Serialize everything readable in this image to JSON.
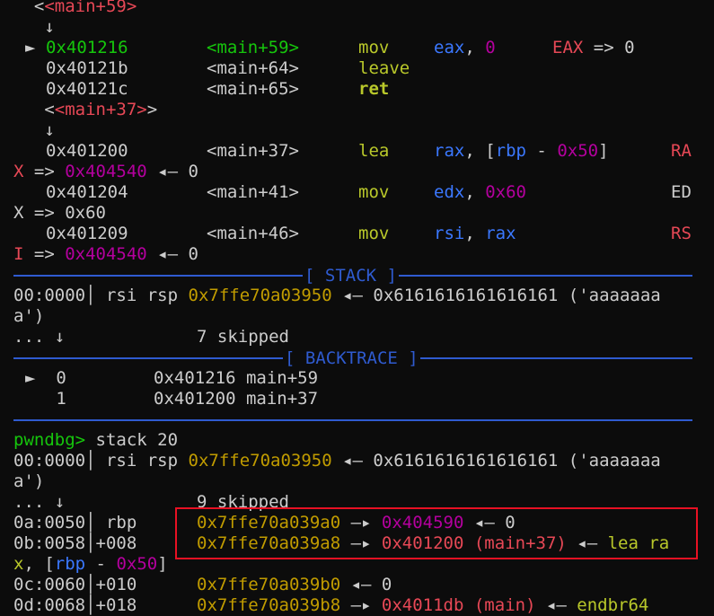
{
  "disasm": {
    "target_top": "<main+59>",
    "arrow_top": "↓",
    "current_marker": "►",
    "rows": [
      {
        "addr": "0x401216",
        "sym": "<main+59>",
        "op": "mov",
        "args": [
          "eax",
          ", ",
          "0"
        ],
        "annot": "EAX => 0"
      },
      {
        "addr": "0x40121b",
        "sym": "<main+64>",
        "op": "leave"
      },
      {
        "addr": "0x40121c",
        "sym": "<main+65>",
        "op": "ret"
      }
    ],
    "target_mid": "<main+37>",
    "arrow_mid": "↓",
    "rows2": [
      {
        "addr": "0x401200",
        "sym": "<main+37>",
        "op": "lea",
        "reg": "rax",
        "mem_open": ", [",
        "base": "rbp",
        "minus": " - ",
        "off": "0x50",
        "mem_close": "]",
        "annot_a": "RA",
        "annot_b": "X",
        "res_sep": " => ",
        "result": "0x404540",
        "deref": " ◂— 0"
      },
      {
        "addr": "0x401204",
        "sym": "<main+41>",
        "op": "mov",
        "reg": "edx",
        "sep": ", ",
        "val": "0x60",
        "annot_a": "ED",
        "annot_b": "X",
        "res_text": " => 0x60"
      },
      {
        "addr": "0x401209",
        "sym": "<main+46>",
        "op": "mov",
        "reg": "rsi",
        "sep": ", ",
        "src": "rax",
        "annot_a": "RS",
        "annot_b": "I",
        "res_sep": " => ",
        "result": "0x404540",
        "deref": " ◂— 0"
      }
    ]
  },
  "stack_header": "[ STACK ]",
  "stack": {
    "idx": "00:0000",
    "regs": "rsi rsp",
    "addr": "0x7ffe70a03950",
    "arrow": " ◂— ",
    "value": "0x6161616161616161 ('aaaaaaa",
    "value_wrap": "a')",
    "skip_dots": "... ↓",
    "skip_text": "7 skipped"
  },
  "backtrace_header": "[ BACKTRACE ]",
  "backtrace": [
    {
      "marker": "►",
      "idx": "0",
      "addr": "0x401216",
      "sym": "main+59"
    },
    {
      "marker": " ",
      "idx": "1",
      "addr": "0x401200",
      "sym": "main+37"
    }
  ],
  "command": {
    "prompt": "pwndbg>",
    "text": " stack 20"
  },
  "stack2": {
    "row0": {
      "idx": "00:0000",
      "regs": "rsi rsp",
      "addr": "0x7ffe70a03950",
      "arrow": " ◂— ",
      "value": "0x6161616161616161 ('aaaaaaa",
      "wrap": "a')"
    },
    "skip_dots": "... ↓",
    "skip_text": "9 skipped",
    "row_rbp": {
      "idx": "0a:0050",
      "label": "rbp",
      "addr": "0x7ffe70a039a0",
      "arrow": " —▸ ",
      "target": "0x404590",
      "deref": " ◂— 0"
    },
    "row_ret": {
      "idx": "0b:0058",
      "label": "+008",
      "addr": "0x7ffe70a039a8",
      "arrow": " —▸ ",
      "target": "0x401200 (main+37)",
      "deref_arrow": " ◂— ",
      "ins": "lea ra",
      "wrap_a": "x",
      "wrap_b": ", [",
      "wrap_reg": "rbp",
      "wrap_minus": " - ",
      "wrap_off": "0x50",
      "wrap_close": "]"
    },
    "row_c": {
      "idx": "0c:0060",
      "label": "+010",
      "addr": "0x7ffe70a039b0",
      "deref": " ◂— 0"
    },
    "row_d": {
      "idx": "0d:0068",
      "label": "+018",
      "addr": "0x7ffe70a039b8",
      "arrow": " —▸ ",
      "target": "0x4011db (main)",
      "deref_arrow": " ◂— ",
      "ins": "endbr64"
    }
  },
  "colors": {
    "background": "#0c0c0c",
    "text": "#cccccc",
    "green": "#16c60c",
    "red": "#e74856",
    "yellow": "#c19c00",
    "magenta": "#b4009e",
    "cyan": "#3b78ff",
    "lime": "#b9c82a",
    "divider_blue": "#2f5bd0",
    "highlight_box": "#e81123"
  }
}
